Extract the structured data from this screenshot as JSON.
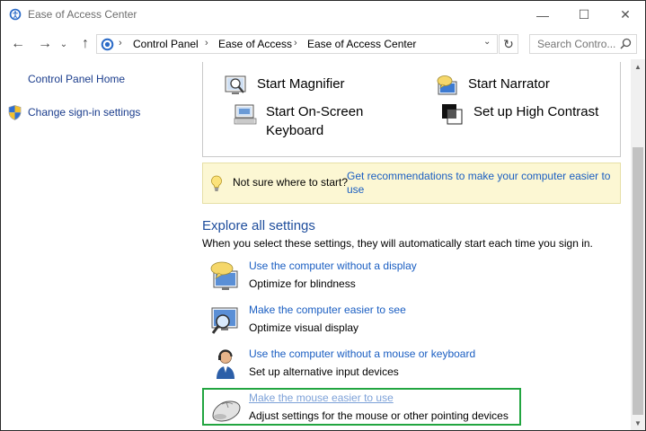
{
  "window": {
    "title": "Ease of Access Center",
    "controls": {
      "minimize": "—",
      "maximize": "☐",
      "close": "✕"
    }
  },
  "nav": {
    "back": "←",
    "forward": "→",
    "recent": "⌄",
    "up": "↑",
    "breadcrumbs": [
      "Control Panel",
      "Ease of Access",
      "Ease of Access Center"
    ],
    "separator": "›",
    "dropdown": "⌄",
    "refresh": "↻",
    "search_placeholder": "Search Contro..."
  },
  "sidebar": {
    "items": [
      {
        "label": "Control Panel Home"
      },
      {
        "label": "Change sign-in settings",
        "icon": "shield-icon"
      }
    ]
  },
  "quick_access": [
    {
      "label": "Start Magnifier",
      "icon": "magnifier-icon"
    },
    {
      "label": "Start Narrator",
      "icon": "narrator-icon"
    },
    {
      "label": "Start On-Screen Keyboard",
      "icon": "keyboard-icon"
    },
    {
      "label": "Set up High Contrast",
      "icon": "high-contrast-icon"
    }
  ],
  "tip": {
    "text": "Not sure where to start?",
    "link": "Get recommendations to make your computer easier to use"
  },
  "explore": {
    "title": "Explore all settings",
    "description": "When you select these settings, they will automatically start each time you sign in.",
    "items": [
      {
        "link": "Use the computer without a display",
        "desc": "Optimize for blindness",
        "icon": "speech-bubble-monitor-icon"
      },
      {
        "link": "Make the computer easier to see",
        "desc": "Optimize visual display",
        "icon": "magnified-monitor-icon"
      },
      {
        "link": "Use the computer without a mouse or keyboard",
        "desc": "Set up alternative input devices",
        "icon": "user-headset-icon"
      },
      {
        "link": "Make the mouse easier to use",
        "desc": "Adjust settings for the mouse or other pointing devices",
        "icon": "mouse-icon"
      }
    ]
  },
  "colors": {
    "link": "#1a5ec2",
    "heading": "#1e4d9c",
    "tip_background": "#fcf7d3",
    "highlight": "#22a540"
  }
}
